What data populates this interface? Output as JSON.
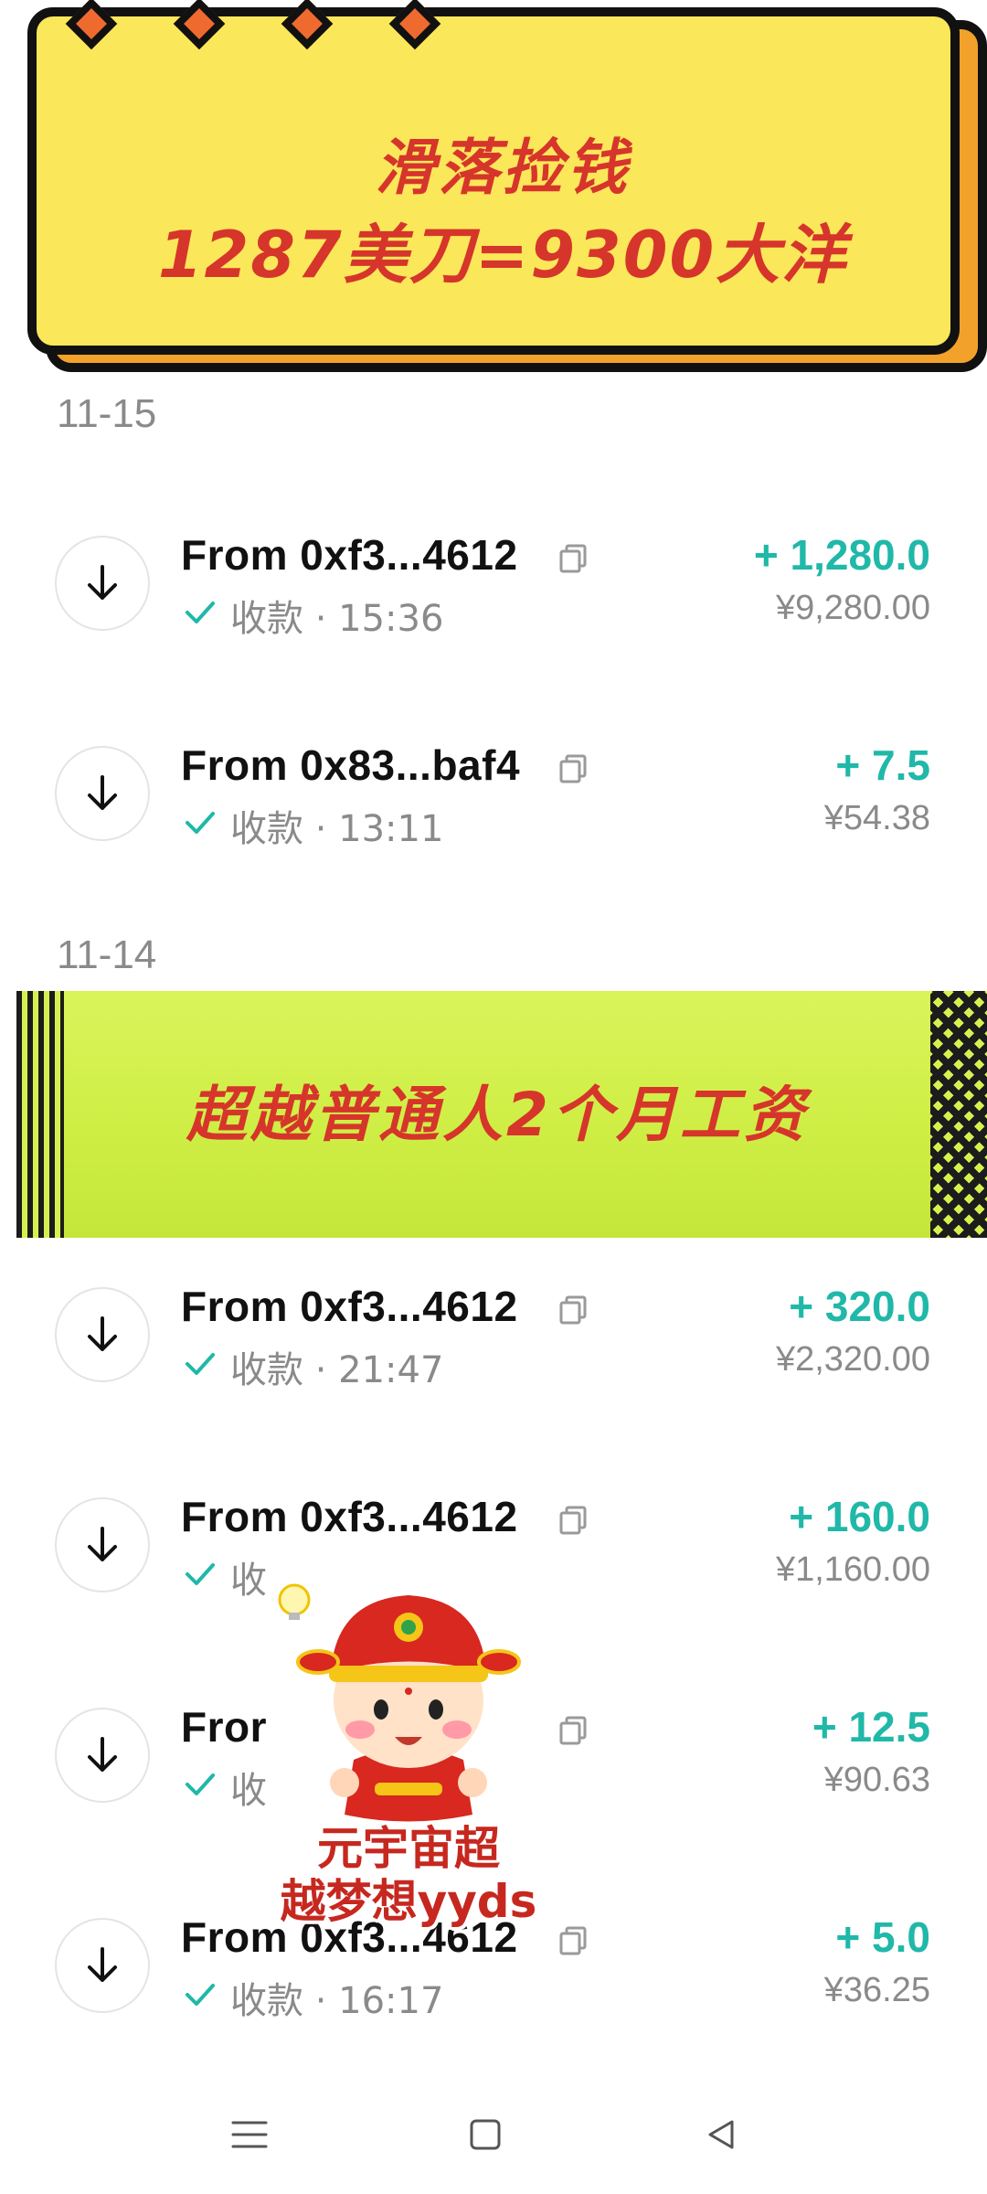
{
  "banner_top": {
    "line1": "滑落捡钱",
    "line2": "1287美刀=9300大洋"
  },
  "banner_mid": {
    "text": "超越普通人2个月工资"
  },
  "mascot": {
    "caption_line1": "元宇宙超",
    "caption_line2": "越梦想yyds"
  },
  "groups": [
    {
      "date": "11-15",
      "transactions": [
        {
          "from": "From 0xf3...4612",
          "status": "收款 · 15:36",
          "amount": "+ 1,280.0",
          "fiat": "¥9,280.00"
        },
        {
          "from": "From 0x83...baf4",
          "status": "收款 · 13:11",
          "amount": "+ 7.5",
          "fiat": "¥54.38"
        }
      ]
    },
    {
      "date": "11-14",
      "transactions": [
        {
          "from": "From 0xf3...4612",
          "status": "收款 · 21:47",
          "amount": "+ 320.0",
          "fiat": "¥2,320.00"
        },
        {
          "from": "From 0xf3...4612",
          "status": "收",
          "amount": "+ 160.0",
          "fiat": "¥1,160.00"
        },
        {
          "from": "Fror",
          "status": "收",
          "amount": "+ 12.5",
          "fiat": "¥90.63"
        },
        {
          "from": "From 0xf3...4612",
          "status": "收款 · 16:17",
          "amount": "+ 5.0",
          "fiat": "¥36.25"
        }
      ]
    }
  ],
  "colors": {
    "amount_teal": "#20b8a8",
    "banner_yellow": "#fbe75a",
    "banner_orange": "#f2a22b",
    "banner_lime": "#cfee45",
    "banner_red_text": "#d6352b"
  },
  "icons": {
    "row_icon": "arrow-down-icon",
    "copy_icon": "copy-icon",
    "status_icon": "check-icon",
    "nav": [
      "menu-icon",
      "home-square-icon",
      "back-triangle-icon"
    ]
  }
}
